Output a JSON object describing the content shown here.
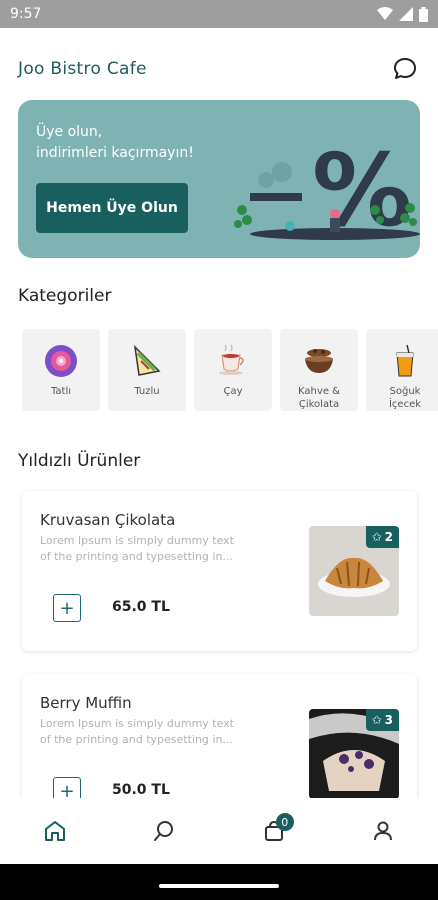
{
  "status_bar": {
    "time": "9:57"
  },
  "header": {
    "title": "Joo Bistro Cafe",
    "chat_icon": "chat-bubble-icon"
  },
  "banner": {
    "line1": "Üye olun,",
    "line2": "indirimleri kaçırmayın!",
    "button_label": "Hemen Üye Olun",
    "bg_color": "#7fb2b2",
    "button_color": "#1a5f5f"
  },
  "categories": {
    "title": "Kategoriler",
    "items": [
      {
        "label": "Tatlı",
        "icon": "lollipop-icon"
      },
      {
        "label": "Tuzlu",
        "icon": "sandwich-icon"
      },
      {
        "label": "Çay",
        "icon": "tea-cup-icon"
      },
      {
        "label": "Kahve &\nÇikolata",
        "icon": "coffee-bowl-icon"
      },
      {
        "label": "Soğuk\nİçecek",
        "icon": "cold-drink-icon"
      }
    ]
  },
  "featured": {
    "title": "Yıldızlı Ürünler",
    "products": [
      {
        "name": "Kruvasan Çikolata",
        "desc_line1": "Lorem Ipsum is simply dummy text",
        "desc_line2": "of the printing and typesetting in...",
        "price": "65.0 TL",
        "rating": "2"
      },
      {
        "name": "Berry Muffin",
        "desc_line1": "Lorem Ipsum is simply dummy text",
        "desc_line2": "of the printing and typesetting in...",
        "price": "50.0 TL",
        "rating": "3"
      }
    ]
  },
  "bottom_nav": {
    "items": [
      "home-icon",
      "search-icon",
      "cart-icon",
      "profile-icon"
    ],
    "cart_count": "0"
  },
  "accent_color": "#1a5f5f"
}
